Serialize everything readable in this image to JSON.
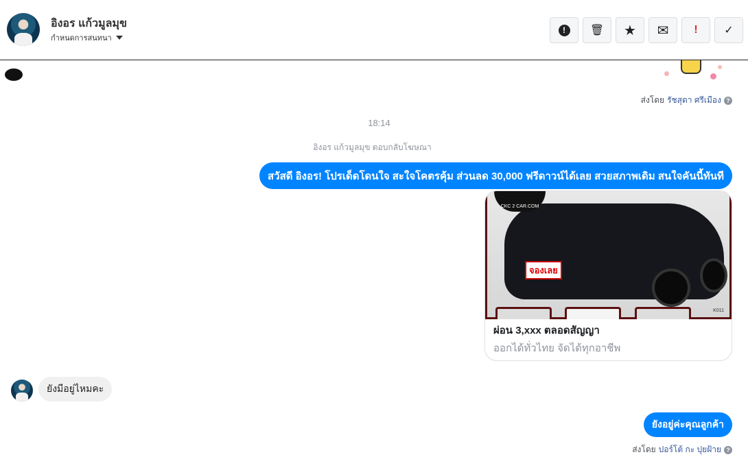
{
  "header": {
    "name": "อิงอร แก้วมูลมุข",
    "assign_label": "กำหนดการสนทนา",
    "actions": [
      {
        "name": "spam",
        "glyph": "!"
      },
      {
        "name": "delete",
        "glyph": "🗑"
      },
      {
        "name": "star",
        "glyph": "★"
      },
      {
        "name": "mark-unread",
        "glyph": "✉"
      },
      {
        "name": "important",
        "glyph": "!"
      },
      {
        "name": "done",
        "glyph": "✓"
      }
    ]
  },
  "messages": {
    "sent_by_1": {
      "prefix": "ส่งโดย",
      "name": "รัชสุดา ศรีเมือง"
    },
    "timestamp": "18:14",
    "reply_note": "อิงอร แก้วมูลมุข ตอบกลับโฆษณา",
    "ad_message": "สวัสดี อิงอร! โปรเด็ดโดนใจ สะใจโคตรคุ้ม ส่วนลด 30,000 ฟรีดาวน์ได้เลย สวยสภาพเดิม สนใจคันนี้ทันที",
    "card": {
      "title": "ผ่อน 3,xxx ตลอดสัญญา",
      "subtitle": "ออกได้ทั่วไทย จัดได้ทุกอาชีพ",
      "image_brand": "CKC 2 CAR.COM",
      "image_tag": "จองเลย",
      "image_code": "K011"
    },
    "incoming": "ยังมีอยู่ไหมคะ",
    "outgoing": "ยังอยู่ค่ะคุณลูกค้า",
    "sent_by_2": {
      "prefix": "ส่งโดย",
      "name": "ปอร์โต้ กะ ปุยฝ้าย"
    },
    "help_glyph": "?"
  },
  "colors": {
    "accent": "#0084ff",
    "important": "#e0262b"
  }
}
